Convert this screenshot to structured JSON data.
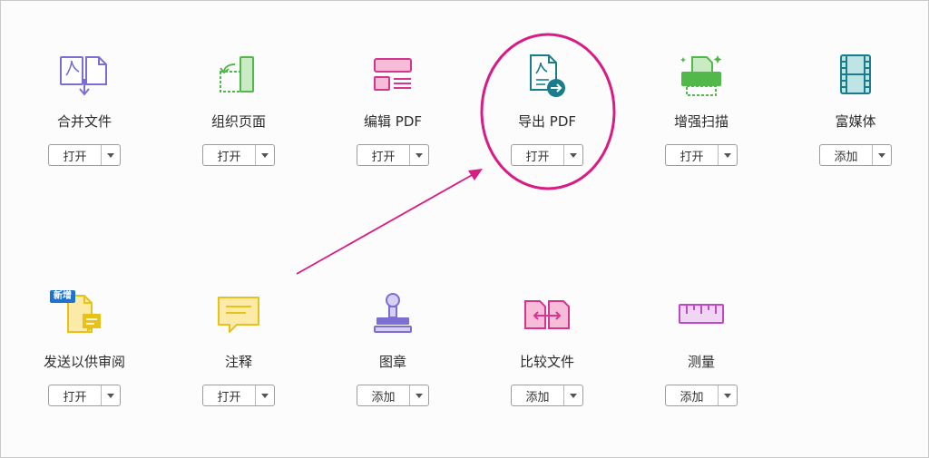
{
  "colors": {
    "accent_purple": "#7b6fd4",
    "green": "#52b84a",
    "pink": "#d6358d",
    "teal": "#1a7d8c",
    "yellow": "#e6c21a",
    "annotation": "#d81b85",
    "badge": "#1f74c9"
  },
  "tools": [
    {
      "label": "合并文件",
      "action": "打开",
      "icon": "combine-files-icon"
    },
    {
      "label": "组织页面",
      "action": "打开",
      "icon": "organize-pages-icon"
    },
    {
      "label": "编辑 PDF",
      "action": "打开",
      "icon": "edit-pdf-icon"
    },
    {
      "label": "导出 PDF",
      "action": "打开",
      "icon": "export-pdf-icon"
    },
    {
      "label": "增强扫描",
      "action": "打开",
      "icon": "enhance-scan-icon"
    },
    {
      "label": "富媒体",
      "action": "添加",
      "icon": "rich-media-icon"
    },
    {
      "label": "发送以供审阅",
      "action": "打开",
      "icon": "send-review-icon",
      "badge": "新增"
    },
    {
      "label": "注释",
      "action": "打开",
      "icon": "comment-icon"
    },
    {
      "label": "图章",
      "action": "添加",
      "icon": "stamp-icon"
    },
    {
      "label": "比较文件",
      "action": "添加",
      "icon": "compare-files-icon"
    },
    {
      "label": "测量",
      "action": "添加",
      "icon": "measure-icon"
    }
  ]
}
